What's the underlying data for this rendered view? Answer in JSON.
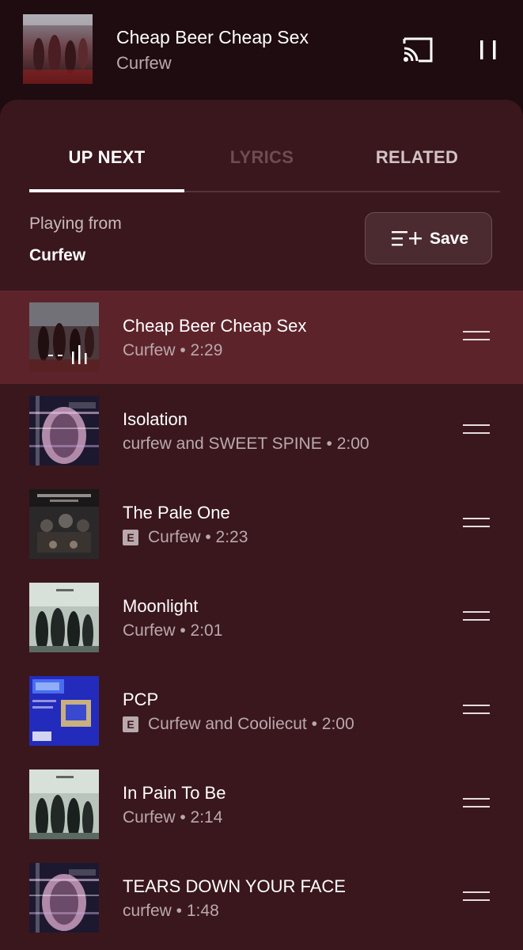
{
  "mini_player": {
    "title": "Cheap Beer Cheap Sex",
    "artist": "Curfew"
  },
  "tabs": [
    {
      "label": "UP NEXT",
      "state": "selected"
    },
    {
      "label": "LYRICS",
      "state": "disabled"
    },
    {
      "label": "RELATED",
      "state": "normal"
    }
  ],
  "playing_from": {
    "label": "Playing from",
    "value": "Curfew"
  },
  "save_button": {
    "label": "Save"
  },
  "queue": [
    {
      "title": "Cheap Beer Cheap Sex",
      "subtitle": "Curfew • 2:29",
      "explicit": false,
      "now_playing": true
    },
    {
      "title": "Isolation",
      "subtitle": "curfew and SWEET SPINE • 2:00",
      "explicit": false
    },
    {
      "title": "The Pale One",
      "subtitle": "Curfew • 2:23",
      "explicit": true,
      "explicit_badge": "E"
    },
    {
      "title": "Moonlight",
      "subtitle": "Curfew • 2:01",
      "explicit": false
    },
    {
      "title": "PCP",
      "subtitle": "Curfew and Cooliecut • 2:00",
      "explicit": true,
      "explicit_badge": "E"
    },
    {
      "title": "In Pain To Be",
      "subtitle": "Curfew • 2:14",
      "explicit": false
    },
    {
      "title": "TEARS DOWN YOUR FACE",
      "subtitle": "curfew • 1:48",
      "explicit": false
    }
  ],
  "icons": {
    "cast": "cast-icon",
    "pause": "pause-icon",
    "save": "playlist-add-icon",
    "drag": "drag-handle-icon",
    "now_playing": "equalizer-icon",
    "explicit": "explicit-icon"
  },
  "colors": {
    "background": "#1e0c10",
    "panel": "#3a171d",
    "active_row": "#5d232b",
    "save_button": "#4b2a30"
  }
}
